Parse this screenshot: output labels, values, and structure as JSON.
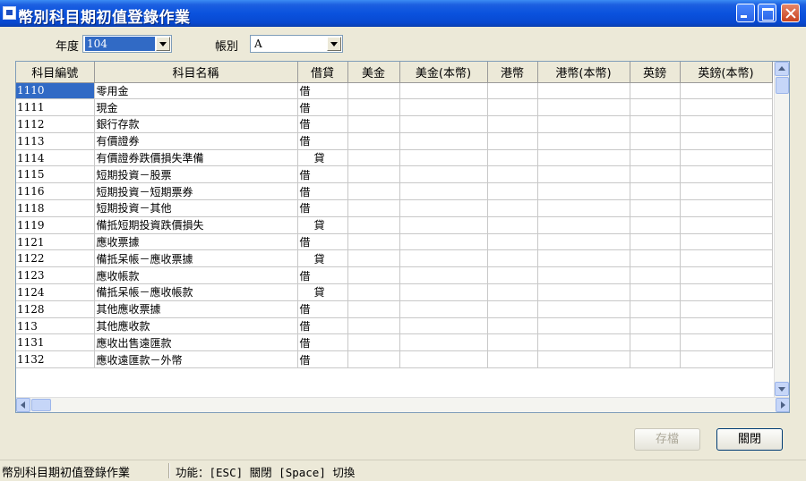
{
  "window": {
    "title": "幣別科目期初值登錄作業"
  },
  "filters": {
    "year_label": "年度",
    "year_value": "104",
    "book_label": "帳別",
    "book_value": "A"
  },
  "grid": {
    "columns": [
      "科目編號",
      "科目名稱",
      "借貸",
      "美金",
      "美金(本幣)",
      "港幣",
      "港幣(本幣)",
      "英鎊",
      "英鎊(本幣)"
    ],
    "rows": [
      {
        "code": "1110",
        "name": "零用金",
        "dc": "借"
      },
      {
        "code": "1111",
        "name": "現金",
        "dc": "借"
      },
      {
        "code": "1112",
        "name": "銀行存款",
        "dc": "借"
      },
      {
        "code": "1113",
        "name": "有價證券",
        "dc": "借"
      },
      {
        "code": "1114",
        "name": "有價證券跌價損失準備",
        "dc": "貸"
      },
      {
        "code": "1115",
        "name": "短期投資－股票",
        "dc": "借"
      },
      {
        "code": "1116",
        "name": "短期投資－短期票券",
        "dc": "借"
      },
      {
        "code": "1118",
        "name": "短期投資－其他",
        "dc": "借"
      },
      {
        "code": "1119",
        "name": "備抵短期投資跌價損失",
        "dc": "貸"
      },
      {
        "code": "1121",
        "name": "應收票據",
        "dc": "借"
      },
      {
        "code": "1122",
        "name": "備抵呆帳－應收票據",
        "dc": "貸"
      },
      {
        "code": "1123",
        "name": "應收帳款",
        "dc": "借"
      },
      {
        "code": "1124",
        "name": "備抵呆帳－應收帳款",
        "dc": "貸"
      },
      {
        "code": "1128",
        "name": "其他應收票據",
        "dc": "借"
      },
      {
        "code": "113",
        "name": "其他應收款",
        "dc": "借"
      },
      {
        "code": "1131",
        "name": "應收出售遠匯款",
        "dc": "借"
      },
      {
        "code": "1132",
        "name": "應收遠匯款－外幣",
        "dc": "借"
      }
    ]
  },
  "buttons": {
    "save": "存檔",
    "close": "關閉"
  },
  "status": {
    "left": "幣別科目期初值登錄作業",
    "right": "功能：[ESC] 關閉 [Space] 切換"
  }
}
